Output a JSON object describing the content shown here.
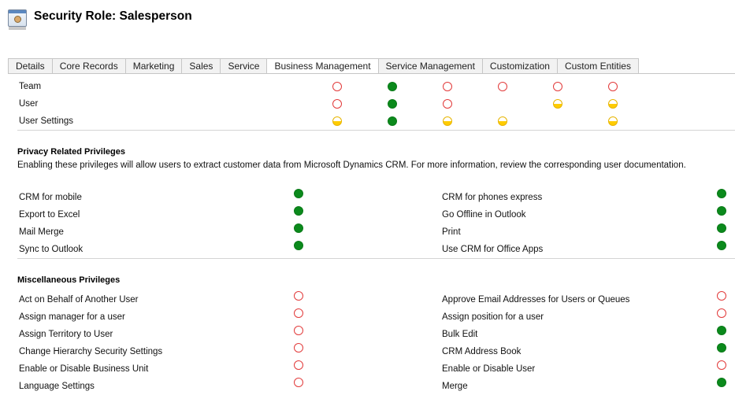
{
  "header": {
    "title": "Security Role: Salesperson"
  },
  "tabs": [
    "Details",
    "Core Records",
    "Marketing",
    "Sales",
    "Service",
    "Business Management",
    "Service Management",
    "Customization",
    "Custom Entities"
  ],
  "active_tab": "Business Management",
  "entity_rows": [
    {
      "label": "Team",
      "levels": [
        "none",
        "full",
        "none",
        "none",
        "none",
        "none"
      ]
    },
    {
      "label": "User",
      "levels": [
        "none",
        "full",
        "none",
        "",
        "half",
        "half"
      ]
    },
    {
      "label": "User Settings",
      "levels": [
        "half",
        "full",
        "half",
        "half",
        "",
        "half"
      ]
    }
  ],
  "privacy": {
    "title": "Privacy Related Privileges",
    "description": "Enabling these privileges will allow users to extract customer data from Microsoft Dynamics CRM. For more information, review the corresponding user documentation.",
    "left": [
      {
        "label": "CRM for mobile",
        "level": "full"
      },
      {
        "label": "Export to Excel",
        "level": "full"
      },
      {
        "label": "Mail Merge",
        "level": "full"
      },
      {
        "label": "Sync to Outlook",
        "level": "full"
      }
    ],
    "right": [
      {
        "label": "CRM for phones express",
        "level": "full"
      },
      {
        "label": "Go Offline in Outlook",
        "level": "full"
      },
      {
        "label": "Print",
        "level": "full"
      },
      {
        "label": "Use CRM for Office Apps",
        "level": "full"
      }
    ]
  },
  "misc": {
    "title": "Miscellaneous Privileges",
    "left": [
      {
        "label": "Act on Behalf of Another User",
        "level": "none"
      },
      {
        "label": "Assign manager for a user",
        "level": "none"
      },
      {
        "label": "Assign Territory to User",
        "level": "none"
      },
      {
        "label": "Change Hierarchy Security Settings",
        "level": "none"
      },
      {
        "label": "Enable or Disable Business Unit",
        "level": "none"
      },
      {
        "label": "Language Settings",
        "level": "none"
      }
    ],
    "right": [
      {
        "label": "Approve Email Addresses for Users or Queues",
        "level": "none"
      },
      {
        "label": "Assign position for a user",
        "level": "none"
      },
      {
        "label": "Bulk Edit",
        "level": "full"
      },
      {
        "label": "CRM Address Book",
        "level": "full"
      },
      {
        "label": "Enable or Disable User",
        "level": "none"
      },
      {
        "label": "Merge",
        "level": "full"
      }
    ]
  },
  "legend_colors": {
    "none": "#e23a3a",
    "full": "#0b8a1c",
    "half": "#ffcc00"
  }
}
